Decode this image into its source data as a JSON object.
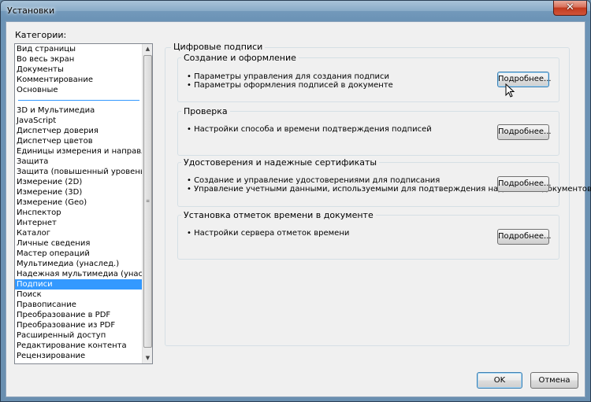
{
  "window": {
    "title": "Установки",
    "close_symbol": "✕"
  },
  "categories": {
    "label": "Категории:",
    "group1": [
      "Вид страницы",
      "Во весь экран",
      "Документы",
      "Комментирование",
      "Основные"
    ],
    "group2": [
      "3D и Мультимедиа",
      "JavaScript",
      "Диспетчер доверия",
      "Диспетчер цветов",
      "Единицы измерения и направляющие",
      "Защита",
      "Защита (повышенный уровень)",
      "Измерение (2D)",
      "Измерение (3D)",
      "Измерение (Geo)",
      "Инспектор",
      "Интернет",
      "Каталог",
      "Личные сведения",
      "Мастер операций",
      "Мультимедиа (унаслед.)",
      "Надежная мультимедиа (унаслед.)",
      "Подписи",
      "Поиск",
      "Правописание",
      "Преобразование в PDF",
      "Преобразование из PDF",
      "Расширенный доступ",
      "Редактирование контента",
      "Рецензирование"
    ],
    "selected": "Подписи"
  },
  "main": {
    "title": "Цифровые подписи",
    "sections": [
      {
        "title": "Создание и оформление",
        "bullets": [
          "• Параметры управления для создания подписи",
          "• Параметры оформления подписей в документе"
        ],
        "button": "Подробнее..."
      },
      {
        "title": "Проверка",
        "bullets": [
          "• Настройки способа и времени подтверждения подписей"
        ],
        "button": "Подробнее..."
      },
      {
        "title": "Удостоверения и надежные сертификаты",
        "bullets": [
          "• Создание и управление удостоверениями для подписания",
          "• Управление учетными данными, используемыми для подтверждения надежности документов"
        ],
        "button": "Подробнее..."
      },
      {
        "title": "Установка отметок времени в документе",
        "bullets": [
          "• Настройки сервера отметок времени"
        ],
        "button": "Подробнее..."
      }
    ]
  },
  "footer": {
    "ok_label": "OK",
    "cancel_label": "Отмена"
  }
}
